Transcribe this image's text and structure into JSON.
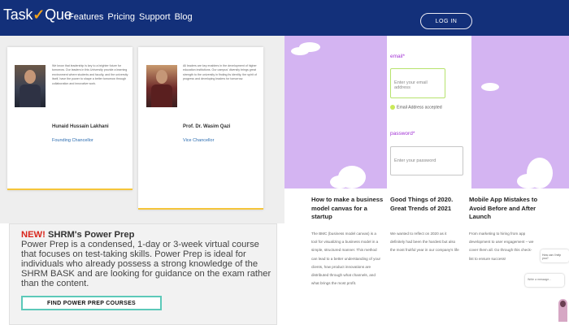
{
  "nav": {
    "logo_part1": "Task",
    "logo_part2": "Que",
    "links": [
      "Features",
      "Pricing",
      "Support",
      "Blog"
    ],
    "login": "LOG IN"
  },
  "leaders": [
    {
      "quote": "We know that leadership is key to a brighter future for tomorrow. Our leaders in this University provide a learning environment where students and faculty, and the university itself, have the power to shape a better tomorrow through collaboration and innovative work.",
      "name": "Hunaid Hussain Lakhani",
      "role": "Founding Chancellor"
    },
    {
      "quote": "All leaders are key enablers in the development of higher education institutions. Our campus' diversity brings great strength to the university in finding its identity, the spirit of progress and developing leaders for tomorrow.",
      "name": "Prof. Dr. Wasim Qazi",
      "role": "Vice Chancellor"
    }
  ],
  "promo": {
    "new_label": "NEW!",
    "heading": "SHRM's Power Prep",
    "body": "Power Prep is a condensed, 1-day or 3-week virtual course that focuses on test-taking skills. Power Prep is ideal for individuals who already possess a strong knowledge of the SHRM BASK and are looking for guidance on the exam rather than the content.",
    "cta": "FIND POWER PREP COURSES"
  },
  "form": {
    "email_label": "email*",
    "email_placeholder": "Enter your email address",
    "email_note": "Email Address accepted",
    "password_label": "password*",
    "password_placeholder": "Enter your password"
  },
  "posts": [
    {
      "title": "How to make a business model canvas for a startup",
      "excerpt": "The BMC (business model canvas) is a tool for visualizing a business model in a simple, structured manner. This method can lead to a better understanding of your clients, how product innovations are distributed through what channels, and what brings the most profit."
    },
    {
      "title": "Good Things of 2020. Great Trends of 2021",
      "excerpt": "We wanted to reflect on 2020 as it definitely had been the hardest but also the most fruitful year in our company's life"
    },
    {
      "title": "Mobile App Mistakes to Avoid Before and After Launch",
      "excerpt": "From marketing to hiring from app development to user engagement – we cover them all. Go through this check-list to ensure success!"
    }
  ],
  "chat": {
    "greeting": "How can I help you?",
    "placeholder": "Write a message..."
  }
}
